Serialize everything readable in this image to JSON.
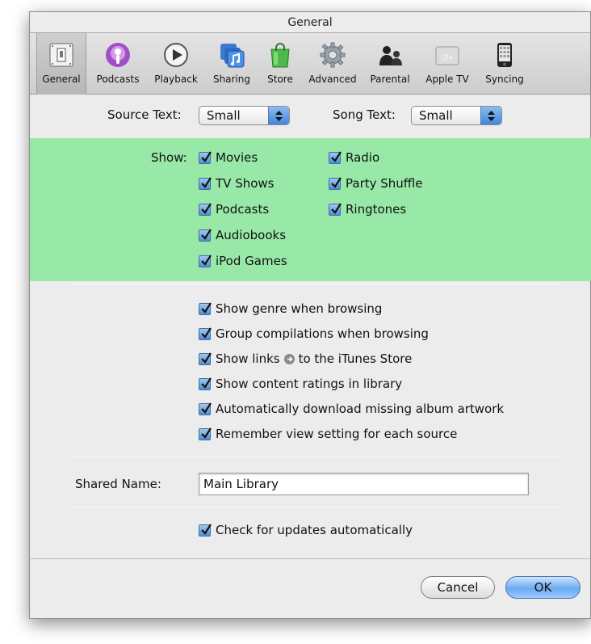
{
  "window": {
    "title": "General"
  },
  "toolbar": {
    "items": [
      {
        "label": "General",
        "icon": "general-icon",
        "selected": true
      },
      {
        "label": "Podcasts",
        "icon": "podcasts-icon"
      },
      {
        "label": "Playback",
        "icon": "playback-icon"
      },
      {
        "label": "Sharing",
        "icon": "sharing-icon"
      },
      {
        "label": "Store",
        "icon": "store-icon"
      },
      {
        "label": "Advanced",
        "icon": "advanced-icon"
      },
      {
        "label": "Parental",
        "icon": "parental-icon"
      },
      {
        "label": "Apple TV",
        "icon": "apple-tv-icon"
      },
      {
        "label": "Syncing",
        "icon": "syncing-icon"
      }
    ]
  },
  "source_text": {
    "label": "Source Text:",
    "value": "Small"
  },
  "song_text": {
    "label": "Song Text:",
    "value": "Small"
  },
  "show": {
    "label": "Show:",
    "left": [
      "Movies",
      "TV Shows",
      "Podcasts",
      "Audiobooks",
      "iPod Games"
    ],
    "right": [
      "Radio",
      "Party Shuffle",
      "Ringtones"
    ],
    "highlight_color": "#98e9a8"
  },
  "options": {
    "genre": "Show genre when browsing",
    "compilations": "Group compilations when browsing",
    "links_prefix": "Show links",
    "links_suffix": "to the iTunes Store",
    "ratings": "Show content ratings in library",
    "artwork": "Automatically download missing album artwork",
    "view_setting": "Remember view setting for each source"
  },
  "shared_name": {
    "label": "Shared Name:",
    "value": "Main Library"
  },
  "updates": {
    "label": "Check for updates automatically"
  },
  "buttons": {
    "cancel": "Cancel",
    "ok": "OK"
  },
  "colors": {
    "accent": "#4f8ed6",
    "selected_toolbar": "#bdbdbd"
  }
}
